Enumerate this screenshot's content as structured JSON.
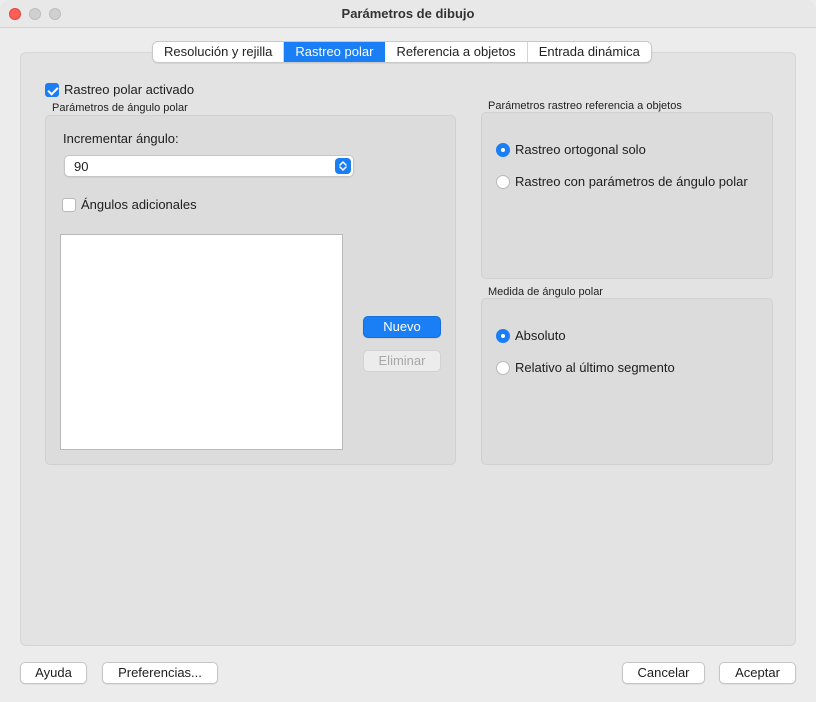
{
  "window": {
    "title": "Parámetros de dibujo"
  },
  "tabs": [
    {
      "label": "Resolución y rejilla",
      "active": false
    },
    {
      "label": "Rastreo polar",
      "active": true
    },
    {
      "label": "Referencia a objetos",
      "active": false
    },
    {
      "label": "Entrada dinámica",
      "active": false
    }
  ],
  "polar_tracking": {
    "enabled_label": "Rastreo polar activado",
    "enabled": true,
    "angle_group_label": "Parámetros de ángulo polar",
    "increment_label": "Incrementar ángulo:",
    "increment_value": "90",
    "additional_label": "Ángulos adicionales",
    "additional_checked": false,
    "new_button": "Nuevo",
    "delete_button": "Eliminar"
  },
  "object_snap_tracking": {
    "group_label": "Parámetros rastreo referencia a objetos",
    "options": [
      {
        "label": "Rastreo ortogonal solo",
        "selected": true
      },
      {
        "label": "Rastreo con parámetros de ángulo polar",
        "selected": false
      }
    ]
  },
  "polar_measurement": {
    "group_label": "Medida de ángulo polar",
    "options": [
      {
        "label": "Absoluto",
        "selected": true
      },
      {
        "label": "Relativo al último segmento",
        "selected": false
      }
    ]
  },
  "footer": {
    "help": "Ayuda",
    "preferences": "Preferencias...",
    "cancel": "Cancelar",
    "accept": "Aceptar"
  },
  "colors": {
    "accent": "#1a7ef5",
    "close": "#ff5f57"
  }
}
